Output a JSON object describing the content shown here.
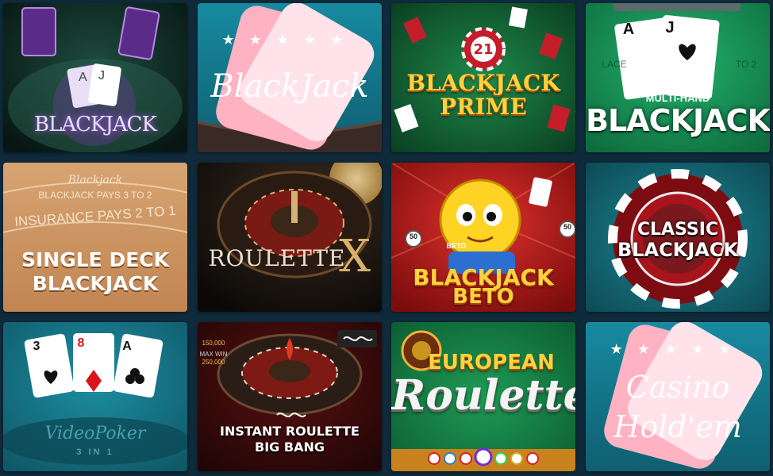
{
  "tiles": [
    {
      "id": "blackjack-classic-purple",
      "title": "BLACKJACK",
      "decor": "BLACKJACK"
    },
    {
      "id": "blackjack-teal",
      "title": "BlackJack"
    },
    {
      "id": "blackjack-prime",
      "title_line1": "BLACKJACK",
      "title_line2": "PRIME",
      "chip_number": "21"
    },
    {
      "id": "multi-hand-blackjack",
      "subtitle": "MULTI-HAND",
      "title": "BLACKJACK",
      "card1": "A",
      "card2": "J",
      "felt_left": "LACE",
      "felt_right": "TO 2"
    },
    {
      "id": "single-deck-blackjack",
      "table_text1": "Blackjack",
      "table_text2": "BLACKJACK PAYS 3 TO 2",
      "table_text3": "INSURANCE PAYS 2 TO 1",
      "title_line1": "SINGLE DECK",
      "title_line2": "BLACKJACK"
    },
    {
      "id": "roulette-x",
      "title": "ROULETTE",
      "title_x": "X"
    },
    {
      "id": "blackjack-beto",
      "title_line1": "BLACKJACK",
      "title_line2": "BETO",
      "badge_text": "BETO",
      "chip1": "50",
      "chip2": "50"
    },
    {
      "id": "classic-blackjack",
      "title_line1": "CLASSIC",
      "title_line2": "BLACKJACK"
    },
    {
      "id": "video-poker-3in1",
      "card1": "3",
      "card2": "8",
      "card3": "A",
      "title": "VideoPoker",
      "subtitle": "3 IN 1"
    },
    {
      "id": "instant-roulette-big-bang",
      "title_line1": "INSTANT ROULETTE",
      "title_line2": "BIG BANG",
      "side1": "150,000",
      "side2": "250,000",
      "side3": "MAX WIN"
    },
    {
      "id": "european-roulette",
      "title_line1": "EUROPEAN",
      "title_line2": "Roulette"
    },
    {
      "id": "casino-holdem",
      "title_line1": "Casino",
      "title_line2": "Hold'em"
    }
  ],
  "colors": {
    "page_bg": "#0f2a3a",
    "teal": "#1a7b8e",
    "green": "#1d9c5a",
    "gold": "#ffd23d"
  }
}
